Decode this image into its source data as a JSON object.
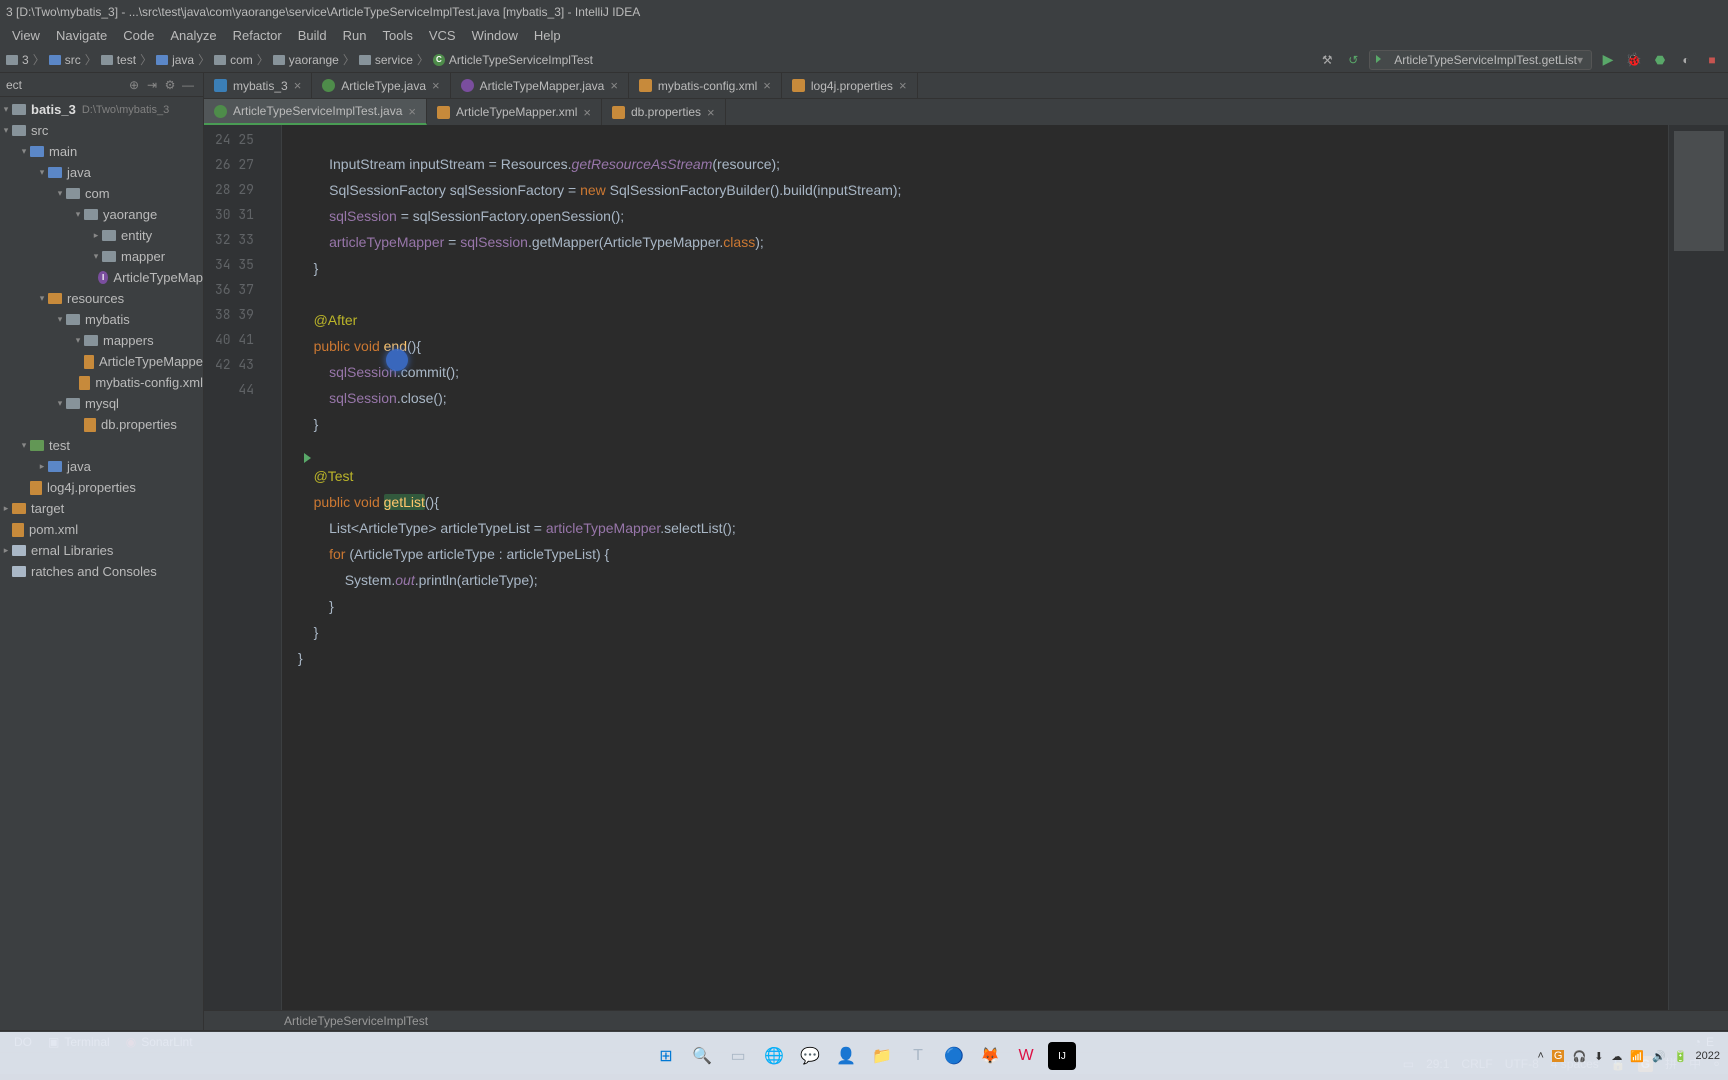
{
  "title_bar": "3 [D:\\Two\\mybatis_3] - ...\\src\\test\\java\\com\\yaorange\\service\\ArticleTypeServiceImplTest.java [mybatis_3] - IntelliJ IDEA",
  "menu": [
    "View",
    "Navigate",
    "Code",
    "Analyze",
    "Refactor",
    "Build",
    "Run",
    "Tools",
    "VCS",
    "Window",
    "Help"
  ],
  "breadcrumb": [
    "3",
    "src",
    "test",
    "java",
    "com",
    "yaorange",
    "service",
    "ArticleTypeServiceImplTest"
  ],
  "run_config": "ArticleTypeServiceImplTest.getList",
  "project": {
    "header": "ect",
    "root": {
      "name": "batis_3",
      "path": "D:\\Two\\mybatis_3"
    },
    "tree": [
      {
        "indent": 0,
        "arrow": "▾",
        "icon": "folder",
        "name": "src"
      },
      {
        "indent": 1,
        "arrow": "▾",
        "icon": "folder-blue",
        "name": "main"
      },
      {
        "indent": 2,
        "arrow": "▾",
        "icon": "folder-blue",
        "name": "java"
      },
      {
        "indent": 3,
        "arrow": "▾",
        "icon": "folder",
        "name": "com"
      },
      {
        "indent": 4,
        "arrow": "▾",
        "icon": "folder",
        "name": "yaorange"
      },
      {
        "indent": 5,
        "arrow": "▸",
        "icon": "folder",
        "name": "entity"
      },
      {
        "indent": 5,
        "arrow": "▾",
        "icon": "folder",
        "name": "mapper"
      },
      {
        "indent": 6,
        "arrow": "",
        "icon": "interface",
        "name": "ArticleTypeMap"
      },
      {
        "indent": 2,
        "arrow": "▾",
        "icon": "folder-orange",
        "name": "resources"
      },
      {
        "indent": 3,
        "arrow": "▾",
        "icon": "folder",
        "name": "mybatis"
      },
      {
        "indent": 4,
        "arrow": "▾",
        "icon": "folder",
        "name": "mappers"
      },
      {
        "indent": 5,
        "arrow": "",
        "icon": "xml",
        "name": "ArticleTypeMappe"
      },
      {
        "indent": 4,
        "arrow": "",
        "icon": "xml",
        "name": "mybatis-config.xml"
      },
      {
        "indent": 3,
        "arrow": "▾",
        "icon": "folder",
        "name": "mysql"
      },
      {
        "indent": 4,
        "arrow": "",
        "icon": "prop",
        "name": "db.properties"
      },
      {
        "indent": 1,
        "arrow": "▾",
        "icon": "folder-green",
        "name": "test"
      },
      {
        "indent": 2,
        "arrow": "▸",
        "icon": "folder-blue",
        "name": "java"
      },
      {
        "indent": 1,
        "arrow": "",
        "icon": "prop",
        "name": "log4j.properties"
      },
      {
        "indent": 0,
        "arrow": "▸",
        "icon": "folder-orange",
        "name": "target"
      },
      {
        "indent": 0,
        "arrow": "",
        "icon": "xml",
        "name": "pom.xml"
      },
      {
        "indent": 0,
        "arrow": "▸",
        "icon": "lib",
        "name": "ernal Libraries"
      },
      {
        "indent": 0,
        "arrow": "",
        "icon": "scratch",
        "name": "ratches and Consoles"
      }
    ]
  },
  "tabs_row1": [
    {
      "icon": "m",
      "label": "mybatis_3",
      "active": false
    },
    {
      "icon": "c",
      "label": "ArticleType.java",
      "active": false
    },
    {
      "icon": "i",
      "label": "ArticleTypeMapper.java",
      "active": false
    },
    {
      "icon": "xml",
      "label": "mybatis-config.xml",
      "active": false
    },
    {
      "icon": "prop",
      "label": "log4j.properties",
      "active": false
    }
  ],
  "tabs_row2": [
    {
      "icon": "c",
      "label": "ArticleTypeServiceImplTest.java",
      "active": true,
      "running": true
    },
    {
      "icon": "xml",
      "label": "ArticleTypeMapper.xml",
      "active": false
    },
    {
      "icon": "prop",
      "label": "db.properties",
      "active": false
    }
  ],
  "line_start": 24,
  "line_end": 44,
  "editor_breadcrumb": "ArticleTypeServiceImplTest",
  "tool_buttons": [
    "DO",
    "Terminal",
    "SonarLint"
  ],
  "status": {
    "pos": "29:1",
    "eol": "CRLF",
    "enc": "UTF-8",
    "indent": "4 spaces",
    "tail": "E"
  },
  "taskbar_time": "2022",
  "code": {
    "l24": {
      "a": "InputStream inputStream = Resources.",
      "b": "getResourceAsStream",
      "c": "(resource);"
    },
    "l25": {
      "a": "SqlSessionFactory sqlSessionFactory = ",
      "b": "new",
      "c": " SqlSessionFactoryBuilder().build(inputStream);"
    },
    "l26": {
      "a": "sqlSession",
      "b": " = sqlSessionFactory.openSession();"
    },
    "l27": {
      "a": "articleTypeMapper",
      "b": " = ",
      "c": "sqlSession",
      "d": ".getMapper(ArticleTypeMapper.",
      "e": "class",
      "f": ");"
    },
    "l28": "}",
    "l30": "@After",
    "l31": {
      "a": "public",
      "b": " void ",
      "c": "end",
      "d": "(){"
    },
    "l32": {
      "a": "sqlSession",
      "b": ".commit();"
    },
    "l33": {
      "a": "sqlSession",
      "b": ".close();"
    },
    "l34": "}",
    "l36": "@Test",
    "l37": {
      "a": "public",
      "b": " void ",
      "c": "getList",
      "d": "(){"
    },
    "l38": {
      "a": "List<ArticleType> articleTypeList = ",
      "b": "articleTypeMapper",
      "c": ".selectList();"
    },
    "l39": {
      "a": "for",
      "b": " (ArticleType articleType : articleTypeList) {"
    },
    "l40": {
      "a": "System.",
      "b": "out",
      "c": ".println(articleType);"
    },
    "l41": "}",
    "l42": "}",
    "l43": "}"
  }
}
